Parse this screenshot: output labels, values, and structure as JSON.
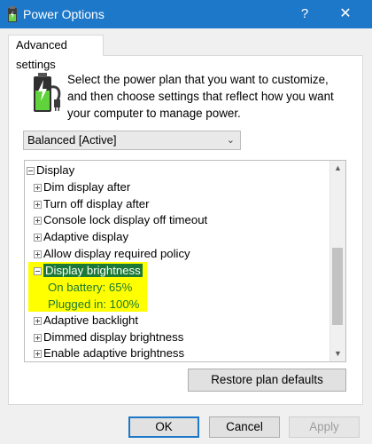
{
  "window": {
    "title": "Power Options",
    "help_icon": "?",
    "close_icon": "✕"
  },
  "tab": {
    "label": "Advanced settings"
  },
  "intro_text": "Select the power plan that you want to customize, and then choose settings that reflect how you want your computer to manage power.",
  "plan_select": {
    "value": "Balanced [Active]"
  },
  "tree": {
    "items": [
      {
        "label": "Display",
        "expander": "minus",
        "level": 0
      },
      {
        "label": "Dim display after",
        "expander": "plus",
        "level": 1
      },
      {
        "label": "Turn off display after",
        "expander": "plus",
        "level": 1
      },
      {
        "label": "Console lock display off timeout",
        "expander": "plus",
        "level": 1
      },
      {
        "label": "Adaptive display",
        "expander": "plus",
        "level": 1
      },
      {
        "label": "Allow display required policy",
        "expander": "plus",
        "level": 1
      },
      {
        "label": "Display brightness",
        "expander": "minus",
        "level": 1,
        "selected": true
      },
      {
        "label": "Adaptive backlight",
        "expander": "plus",
        "level": 1
      },
      {
        "label": "Dimmed display brightness",
        "expander": "plus",
        "level": 1
      },
      {
        "label": "Enable adaptive brightness",
        "expander": "plus",
        "level": 1
      }
    ],
    "brightness_settings": {
      "on_battery_label": "On battery:",
      "on_battery_value": "65%",
      "plugged_in_label": "Plugged in:",
      "plugged_in_value": "100%"
    },
    "highlight_color": "#ffff00",
    "selection_color": "#1b7836"
  },
  "buttons": {
    "restore": "Restore plan defaults",
    "ok": "OK",
    "cancel": "Cancel",
    "apply": "Apply"
  },
  "colors": {
    "titlebar": "#1e78c9",
    "dialog_bg": "#f0f0f0"
  }
}
